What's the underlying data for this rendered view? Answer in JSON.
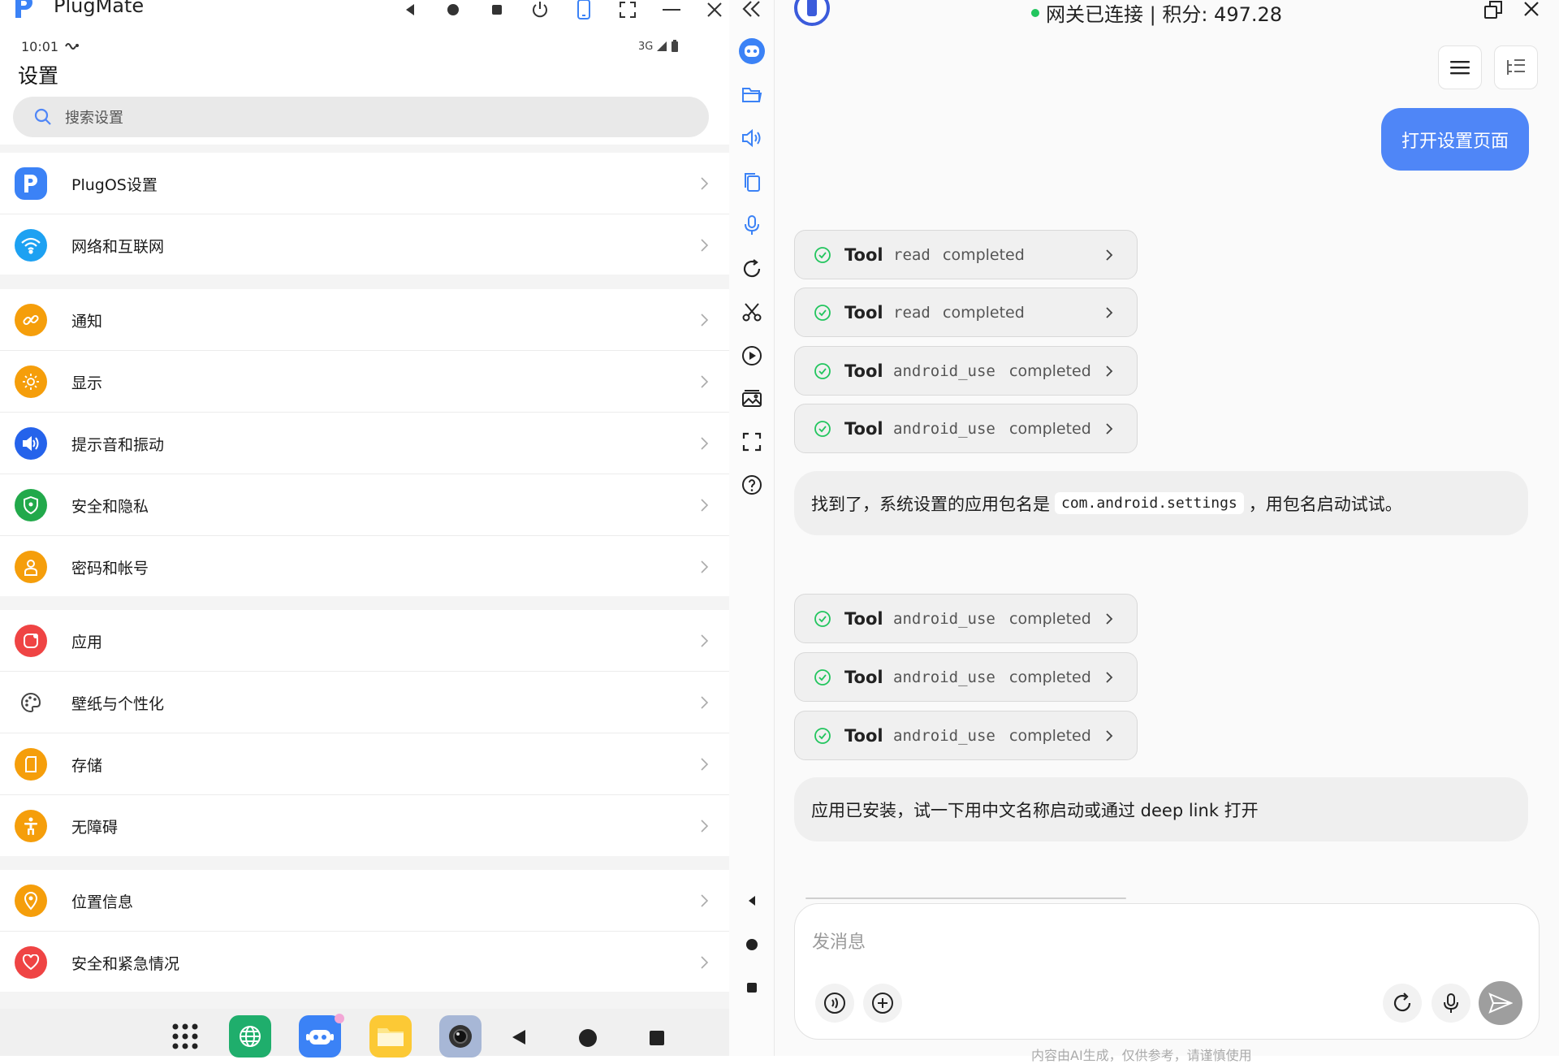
{
  "app": {
    "title": "PlugMate"
  },
  "phone": {
    "status_time": "10:01",
    "status_net": "3G",
    "settings_title": "设置",
    "search_placeholder": "搜索设置",
    "items": [
      {
        "label": "PlugOS设置",
        "icon": "plugos-icon",
        "color": "#3b82f6"
      },
      {
        "label": "网络和互联网",
        "icon": "wifi-icon",
        "color": "#1da1f2"
      },
      {
        "label": "通知",
        "icon": "notification-icon",
        "color": "#f59e0b"
      },
      {
        "label": "显示",
        "icon": "display-icon",
        "color": "#f59e0b"
      },
      {
        "label": "提示音和振动",
        "icon": "sound-icon",
        "color": "#2563eb"
      },
      {
        "label": "安全和隐私",
        "icon": "shield-icon",
        "color": "#22a94b"
      },
      {
        "label": "密码和帐号",
        "icon": "account-icon",
        "color": "#f59e0b"
      },
      {
        "label": "应用",
        "icon": "apps-icon",
        "color": "#ef4444"
      },
      {
        "label": "壁纸与个性化",
        "icon": "palette-icon",
        "color": "#555555"
      },
      {
        "label": "存储",
        "icon": "storage-icon",
        "color": "#f59e0b"
      },
      {
        "label": "无障碍",
        "icon": "accessibility-icon",
        "color": "#f59e0b"
      },
      {
        "label": "位置信息",
        "icon": "location-icon",
        "color": "#f59e0b"
      },
      {
        "label": "安全和紧急情况",
        "icon": "emergency-icon",
        "color": "#ef4444"
      }
    ]
  },
  "chat": {
    "status": "网关已连接 | 积分: 497.28",
    "user_message": "打开设置页面",
    "tool_label": "Tool",
    "tool_status": "completed",
    "tool_calls_1": [
      "read",
      "read",
      "android_use",
      "android_use"
    ],
    "tool_calls_2": [
      "android_use",
      "android_use",
      "android_use"
    ],
    "bot_message_1_before": "找到了，系统设置的应用包名是",
    "bot_message_1_code": "com.android.settings",
    "bot_message_1_after": "，用包名启动试试。",
    "bot_message_2": "应用已安装，试一下用中文名称启动或通过 deep link 打开",
    "input_placeholder": "发消息",
    "footnote": "内容由AI生成，仅供参考，请谨慎使用"
  },
  "colors": {
    "accent": "#4f86f7",
    "success": "#22c55e"
  }
}
